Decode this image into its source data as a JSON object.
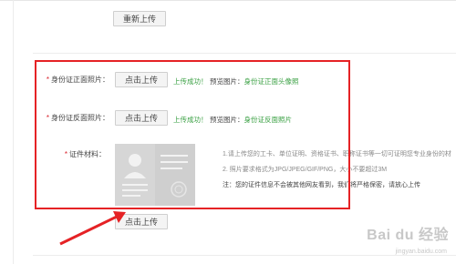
{
  "top_button": "重新上传",
  "upload_label": "点击上传",
  "rows": [
    {
      "label": "身份证正面照片：",
      "upload_button": "点击上传",
      "status": "上传成功！",
      "preview_prefix": "预览图片：",
      "preview_link": "身份证正面头像照"
    },
    {
      "label": "身份证反面照片：",
      "upload_button": "点击上传",
      "status": "上传成功！",
      "preview_prefix": "预览图片：",
      "preview_link": "身份证反面照片"
    }
  ],
  "cert": {
    "label": "证件材料：",
    "upload_button": "点击上传",
    "notes": [
      "1.请上传您的工卡、单位证明、资格证书、职称证书等一切可证明您专业身份的材",
      "2. 照片要求格式为JPG/JPEG/GIF/PNG，大小不要超过3M",
      "注：您的证件信息不会被其他网友看到，我们将严格保密，请放心上传"
    ]
  },
  "watermark": {
    "brand": "Bai du 经验",
    "url": "jingyan.baidu.com"
  },
  "colors": {
    "annotation_red": "#e52225",
    "success_green": "#3aa043",
    "required_red": "#d9232d"
  }
}
